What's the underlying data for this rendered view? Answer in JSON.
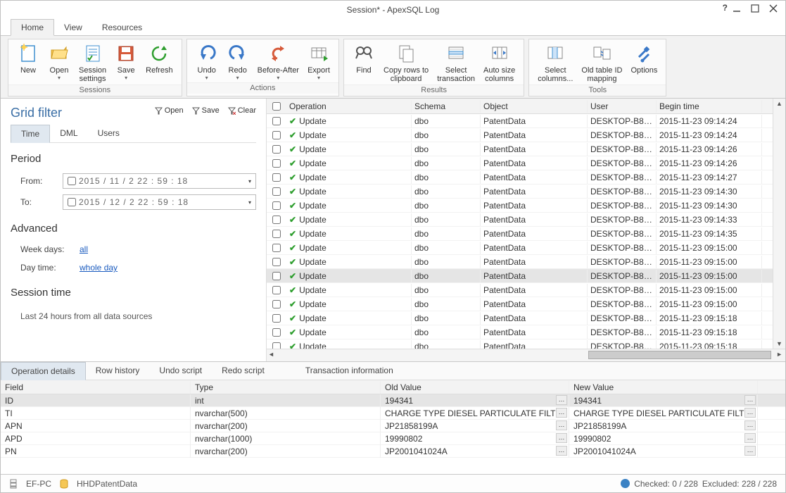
{
  "window": {
    "title": "Session* - ApexSQL Log"
  },
  "tabs": {
    "home": "Home",
    "view": "View",
    "resources": "Resources"
  },
  "ribbon": {
    "sessions": {
      "label": "Sessions",
      "new": "New",
      "open": "Open",
      "settings": "Session\nsettings",
      "save": "Save",
      "refresh": "Refresh"
    },
    "actions": {
      "label": "Actions",
      "undo": "Undo",
      "redo": "Redo",
      "before_after": "Before-After",
      "export": "Export"
    },
    "results": {
      "label": "Results",
      "find": "Find",
      "copy": "Copy rows to\nclipboard",
      "select_tx": "Select\ntransaction",
      "auto_size": "Auto size\ncolumns"
    },
    "tools": {
      "label": "Tools",
      "select_cols": "Select\ncolumns...",
      "old_id": "Old table ID\nmapping",
      "options": "Options"
    }
  },
  "filter": {
    "title": "Grid filter",
    "actions": {
      "open": "Open",
      "save": "Save",
      "clear": "Clear"
    },
    "tabs": {
      "time": "Time",
      "dml": "DML",
      "users": "Users"
    },
    "period_h": "Period",
    "from_label": "From:",
    "from_value": "2015 / 11 /   2    22 : 59 : 18",
    "to_label": "To:",
    "to_value": "2015 / 12 /   2    22 : 59 : 18",
    "advanced_h": "Advanced",
    "weekdays_k": "Week days:",
    "weekdays_v": "all",
    "daytime_k": "Day time:",
    "daytime_v": "whole day",
    "session_h": "Session time",
    "session_note": "Last 24 hours from all data sources"
  },
  "grid": {
    "headers": {
      "operation": "Operation",
      "schema": "Schema",
      "object": "Object",
      "user": "User",
      "begin": "Begin time"
    },
    "op_label": "Update",
    "schema_val": "dbo",
    "object_val": "PatentData",
    "user_val": "DESKTOP-B8E...",
    "rows": [
      {
        "time": "2015-11-23 09:14:24",
        "sel": false
      },
      {
        "time": "2015-11-23 09:14:24",
        "sel": false
      },
      {
        "time": "2015-11-23 09:14:26",
        "sel": false
      },
      {
        "time": "2015-11-23 09:14:26",
        "sel": false
      },
      {
        "time": "2015-11-23 09:14:27",
        "sel": false
      },
      {
        "time": "2015-11-23 09:14:30",
        "sel": false
      },
      {
        "time": "2015-11-23 09:14:30",
        "sel": false
      },
      {
        "time": "2015-11-23 09:14:33",
        "sel": false
      },
      {
        "time": "2015-11-23 09:14:35",
        "sel": false
      },
      {
        "time": "2015-11-23 09:15:00",
        "sel": false
      },
      {
        "time": "2015-11-23 09:15:00",
        "sel": false
      },
      {
        "time": "2015-11-23 09:15:00",
        "sel": true
      },
      {
        "time": "2015-11-23 09:15:00",
        "sel": false
      },
      {
        "time": "2015-11-23 09:15:00",
        "sel": false
      },
      {
        "time": "2015-11-23 09:15:18",
        "sel": false
      },
      {
        "time": "2015-11-23 09:15:18",
        "sel": false
      },
      {
        "time": "2015-11-23 09:15:18",
        "sel": false
      }
    ]
  },
  "details": {
    "tabs": {
      "op": "Operation details",
      "row": "Row history",
      "undo": "Undo script",
      "redo": "Redo script",
      "tx": "Transaction information"
    },
    "headers": {
      "field": "Field",
      "type": "Type",
      "old": "Old Value",
      "new": "New Value"
    },
    "rows": [
      {
        "f": "ID",
        "t": "int",
        "o": "194341",
        "n": "194341",
        "sel": true
      },
      {
        "f": "TI",
        "t": "nvarchar(500)",
        "o": "CHARGE TYPE DIESEL PARTICULATE FILTE...",
        "n": "CHARGE TYPE DIESEL PARTICULATE FILTE...",
        "sel": false
      },
      {
        "f": "APN",
        "t": "nvarchar(200)",
        "o": "JP21858199A",
        "n": "JP21858199A",
        "sel": false
      },
      {
        "f": "APD",
        "t": "nvarchar(1000)",
        "o": "19990802",
        "n": "19990802",
        "sel": false
      },
      {
        "f": "PN",
        "t": "nvarchar(200)",
        "o": "JP2001041024A",
        "n": "JP2001041024A",
        "sel": false
      }
    ]
  },
  "status": {
    "server": "EF-PC",
    "db": "HHDPatentData",
    "checked": "Checked: 0 / 228",
    "excluded": "Excluded: 228 / 228"
  }
}
